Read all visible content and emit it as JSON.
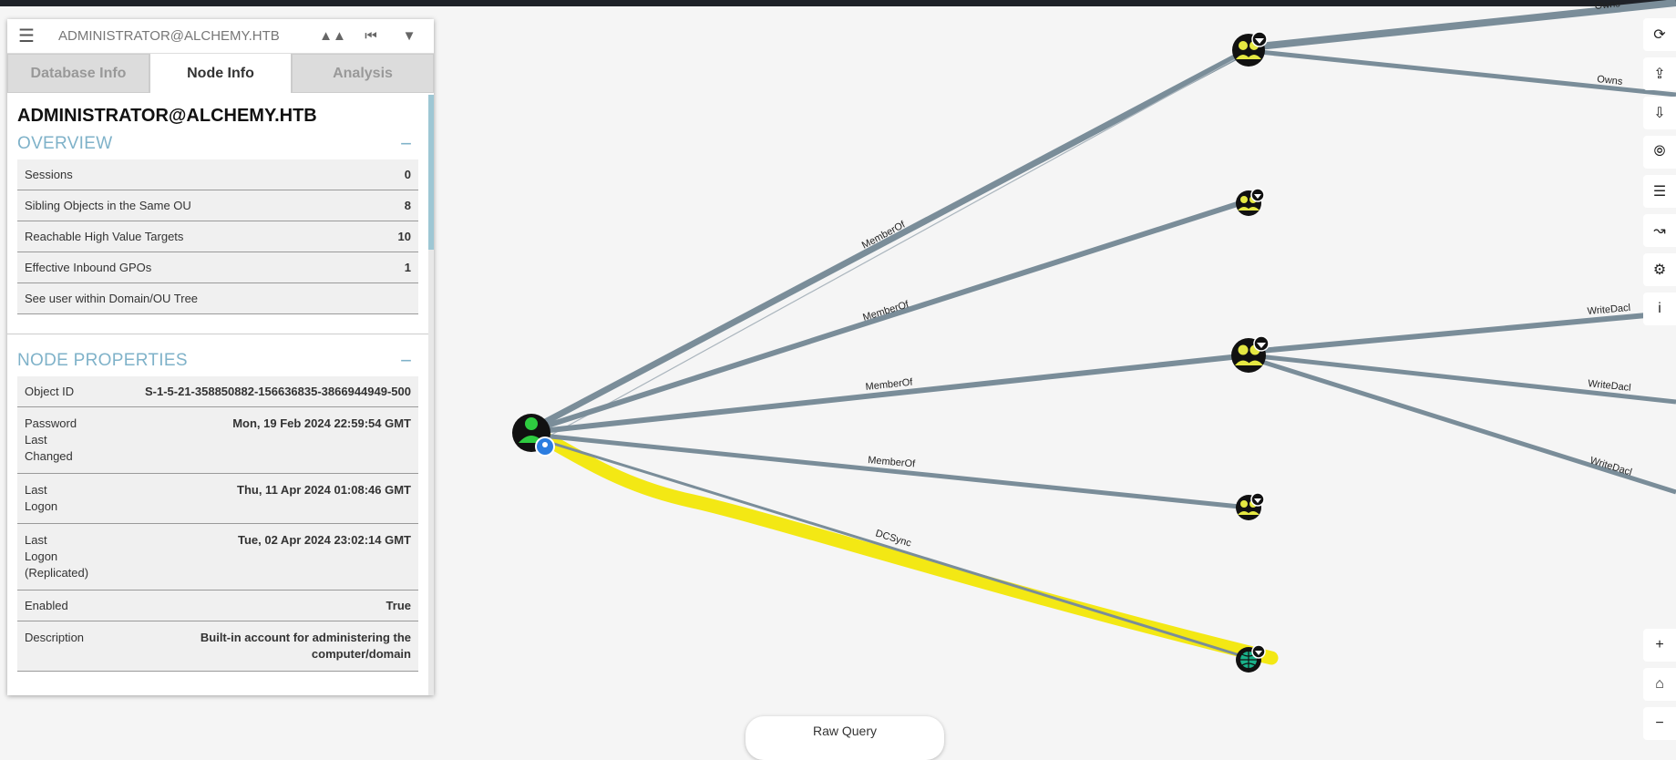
{
  "search": {
    "value": "ADMINISTRATOR@ALCHEMY.HTB",
    "menu_icon": "hamburger-icon"
  },
  "toolbar": {
    "icons": [
      "pathfinding-icon",
      "back-icon",
      "filter-icon"
    ]
  },
  "tabs": [
    {
      "label": "Database Info",
      "active": false
    },
    {
      "label": "Node Info",
      "active": true
    },
    {
      "label": "Analysis",
      "active": false
    }
  ],
  "node": {
    "title": "ADMINISTRATOR@ALCHEMY.HTB",
    "overview": {
      "heading": "OVERVIEW",
      "collapse": "−",
      "rows": [
        {
          "key": "Sessions",
          "value": "0"
        },
        {
          "key": "Sibling Objects in the Same OU",
          "value": "8"
        },
        {
          "key": "Reachable High Value Targets",
          "value": "10"
        },
        {
          "key": "Effective Inbound GPOs",
          "value": "1"
        },
        {
          "key": "See user within Domain/OU Tree",
          "value": ""
        }
      ]
    },
    "properties": {
      "heading": "NODE PROPERTIES",
      "collapse": "−",
      "rows": [
        {
          "key": "Object ID",
          "value": "S-1-5-21-358850882-156636835-3866944949-500"
        },
        {
          "key": "Password Last Changed",
          "value": "Mon, 19 Feb 2024 22:59:54 GMT"
        },
        {
          "key": "Last Logon",
          "value": "Thu, 11 Apr 2024 01:08:46 GMT"
        },
        {
          "key": "Last Logon (Replicated)",
          "value": "Tue, 02 Apr 2024 23:02:14 GMT"
        },
        {
          "key": "Enabled",
          "value": "True"
        },
        {
          "key": "Description",
          "value": "Built-in account for administering the computer/domain"
        }
      ]
    }
  },
  "graph": {
    "edge_labels": {
      "memberof": "MemberOf",
      "dcsync": "DCSync",
      "owns": "Owns",
      "writedacl": "WriteDacl"
    },
    "colors": {
      "edge": "#7a8d99",
      "highlight": "#f2e600",
      "user_node": "#2ecc40",
      "group_node": "#e5e842",
      "domain_node": "#19b28a"
    }
  },
  "right_toolbar": {
    "top": [
      "refresh-icon",
      "upload-icon",
      "download-icon",
      "import-icon",
      "query-list-icon",
      "chart-icon",
      "settings-icon",
      "info-icon"
    ],
    "bottom": [
      "zoom-in-icon",
      "home-icon",
      "zoom-out-icon"
    ],
    "info_label": "i",
    "zoom_in_label": "+",
    "zoom_out_label": "−"
  },
  "raw_query": {
    "label": "Raw Query"
  }
}
